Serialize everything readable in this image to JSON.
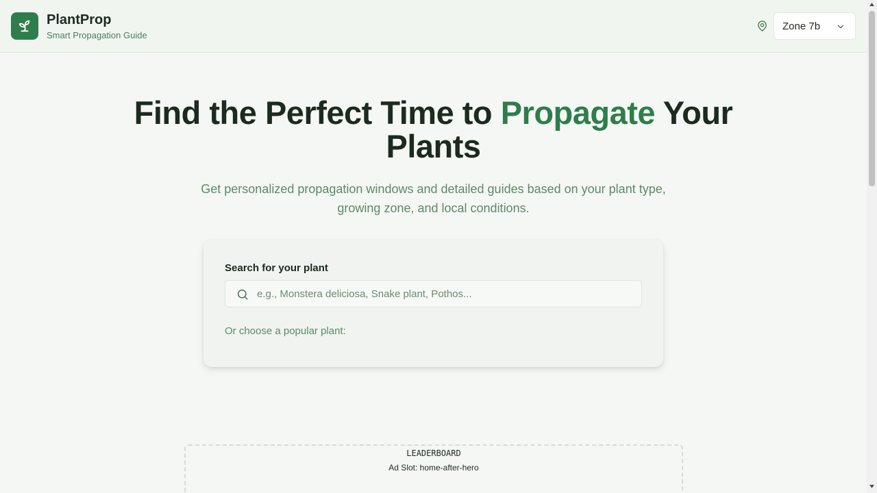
{
  "header": {
    "brand_title": "PlantProp",
    "brand_subtitle": "Smart Propagation Guide",
    "logo_icon": "sprout-icon",
    "location_icon": "map-pin-icon",
    "zone_select": {
      "value": "Zone 7b"
    }
  },
  "hero": {
    "title_part1": "Find the Perfect Time to ",
    "title_accent": "Propagate",
    "title_part2": " Your Plants",
    "subtitle": "Get personalized propagation windows and detailed guides based on your plant type, growing zone, and local conditions."
  },
  "search": {
    "label": "Search for your plant",
    "placeholder": "e.g., Monstera deliciosa, Snake plant, Pothos...",
    "value": "",
    "popular_label": "Or choose a popular plant:"
  },
  "ad": {
    "type": "LEADERBOARD",
    "slot": "Ad Slot: home-after-hero"
  },
  "colors": {
    "accent": "#2e7d4b",
    "muted_text": "#5b8a67",
    "background": "#f5f7f4"
  }
}
